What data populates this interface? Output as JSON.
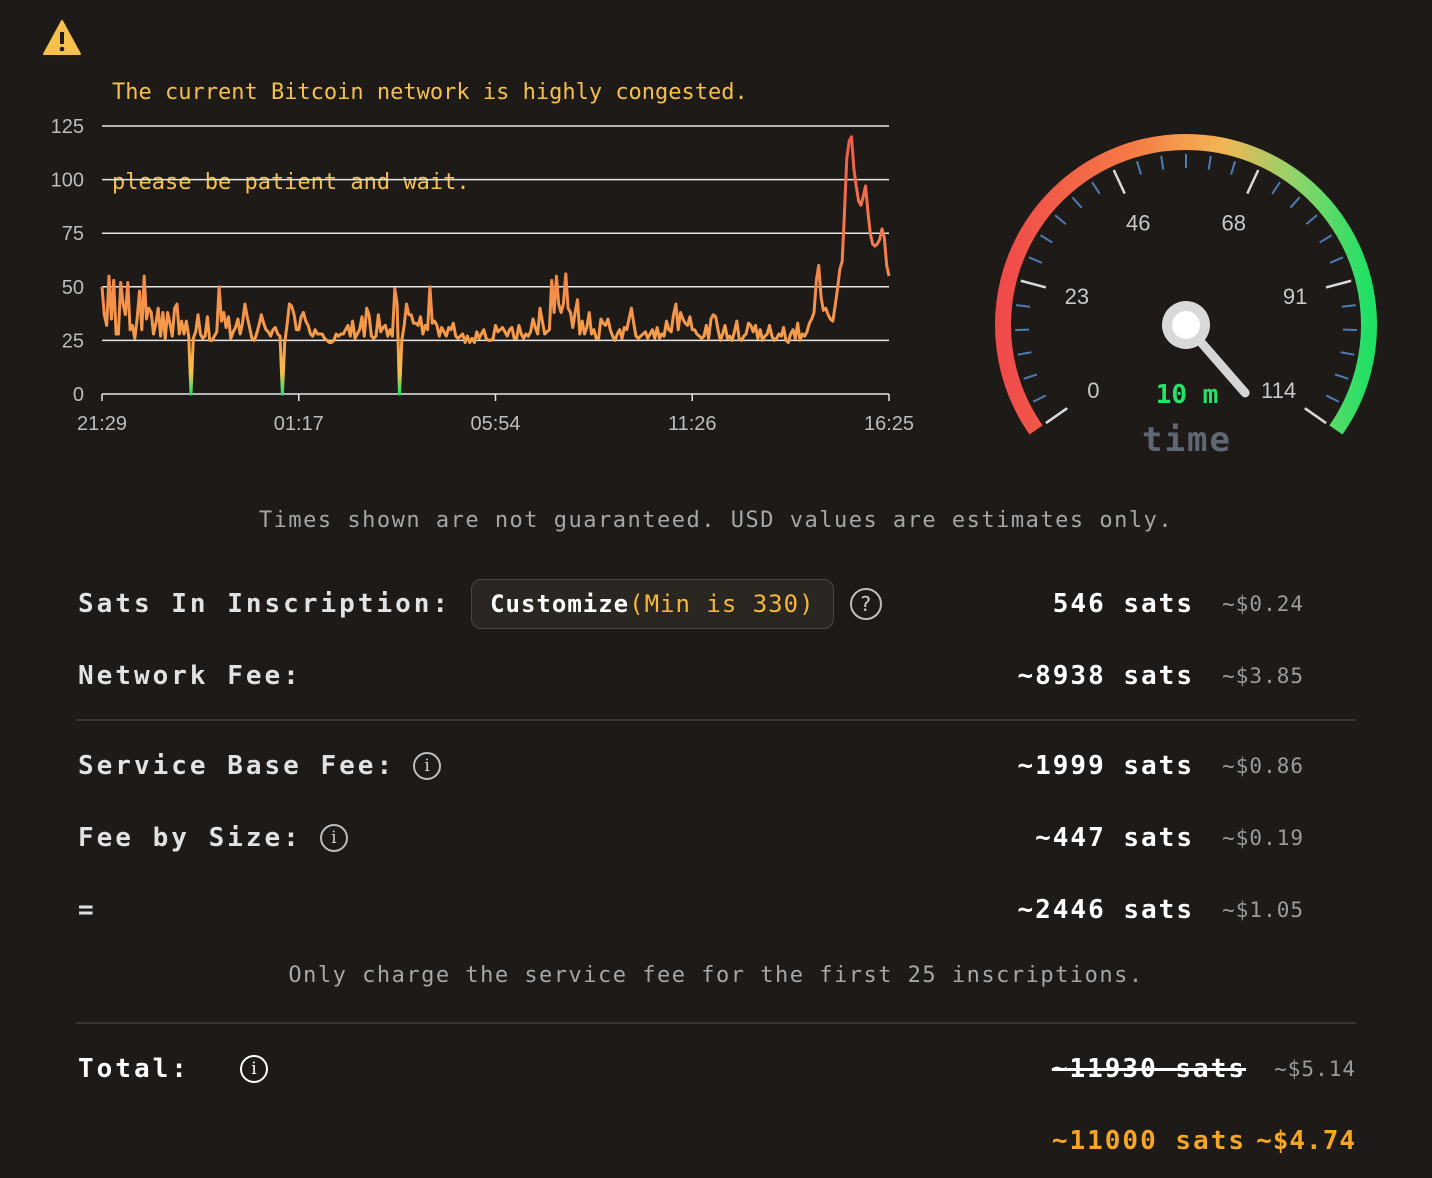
{
  "warning": {
    "icon": "warning-triangle-icon",
    "line1": "The current Bitcoin network is highly congested.",
    "line2": "please be patient and wait."
  },
  "chart_data": {
    "type": "line",
    "y_ticks": [
      "0",
      "25",
      "50",
      "75",
      "100",
      "125"
    ],
    "x_ticks": [
      "21:29",
      "01:17",
      "05:54",
      "11:26",
      "16:25"
    ],
    "ylim": [
      0,
      125
    ],
    "grid": true,
    "series": [
      {
        "values": [
          50,
          37,
          32,
          55,
          35,
          53,
          28,
          28,
          52,
          42,
          37,
          52,
          30,
          32,
          26,
          35,
          48,
          30,
          55,
          35,
          40,
          38,
          28,
          33,
          40,
          27,
          38,
          26,
          38,
          33,
          27,
          40,
          42,
          28,
          34,
          28,
          34,
          27,
          0,
          26,
          29,
          37,
          28,
          26,
          27,
          36,
          25,
          25,
          27,
          29,
          50,
          34,
          38,
          31,
          36,
          26,
          29,
          31,
          35,
          28,
          33,
          42,
          36,
          31,
          26,
          25,
          28,
          32,
          37,
          33,
          30,
          29,
          27,
          30,
          31,
          28,
          27,
          0,
          24,
          32,
          42,
          41,
          37,
          30,
          30,
          36,
          38,
          34,
          32,
          28,
          27,
          30,
          28,
          28,
          28,
          26,
          25,
          24,
          24,
          25,
          28,
          27,
          28,
          28,
          30,
          32,
          27,
          34,
          26,
          28,
          30,
          36,
          27,
          40,
          37,
          27,
          26,
          27,
          37,
          29,
          31,
          32,
          27,
          30,
          27,
          49,
          42,
          0,
          25,
          32,
          42,
          37,
          37,
          33,
          33,
          32,
          36,
          28,
          32,
          30,
          50,
          33,
          34,
          32,
          27,
          31,
          29,
          27,
          31,
          30,
          33,
          27,
          26,
          27,
          28,
          24,
          27,
          24,
          26,
          24,
          29,
          26,
          28,
          30,
          26,
          25,
          25,
          26,
          32,
          29,
          30,
          31,
          29,
          27,
          30,
          31,
          26,
          26,
          32,
          28,
          26,
          28,
          27,
          29,
          35,
          31,
          28,
          40,
          34,
          28,
          29,
          30,
          53,
          38,
          55,
          42,
          38,
          42,
          56,
          40,
          38,
          31,
          38,
          44,
          28,
          34,
          28,
          31,
          38,
          28,
          30,
          26,
          26,
          35,
          33,
          32,
          35,
          30,
          27,
          25,
          28,
          30,
          26,
          31,
          30,
          35,
          40,
          33,
          27,
          26,
          27,
          28,
          29,
          26,
          28,
          30,
          26,
          31,
          26,
          28,
          27,
          34,
          30,
          29,
          37,
          42,
          30,
          38,
          35,
          33,
          32,
          36,
          30,
          30,
          28,
          27,
          26,
          27,
          32,
          26,
          35,
          37,
          36,
          30,
          25,
          28,
          32,
          26,
          27,
          25,
          29,
          34,
          26,
          25,
          27,
          28,
          33,
          32,
          29,
          32,
          26,
          30,
          25,
          27,
          28,
          32,
          27,
          25,
          26,
          28,
          27,
          31,
          25,
          24,
          28,
          30,
          26,
          33,
          25,
          28,
          27,
          29,
          33,
          35,
          38,
          53,
          60,
          45,
          39,
          40,
          37,
          35,
          34,
          41,
          49,
          58,
          62,
          85,
          110,
          118,
          120,
          105,
          97,
          90,
          88,
          92,
          97,
          85,
          75,
          70,
          69,
          70,
          72,
          77,
          73,
          60,
          55
        ]
      }
    ]
  },
  "gauge": {
    "ticks": [
      "0",
      "23",
      "46",
      "68",
      "91",
      "114"
    ],
    "value": 10,
    "time_value": "10 m",
    "time_label": "time"
  },
  "disclaimer1": "Times shown are not guaranteed. USD values are estimates only.",
  "rows": {
    "inscription": {
      "label": "Sats In Inscription:",
      "customize": "Customize",
      "min": "(Min is 330)",
      "help_icon": "question-circle-icon",
      "sats": "546 sats",
      "usd": "~$0.24"
    },
    "network": {
      "label": "Network Fee:",
      "sats": "~8938 sats",
      "usd": "~$3.85"
    },
    "service_base": {
      "label": "Service Base Fee:",
      "info_icon": "info-circle-icon",
      "sats": "~1999 sats",
      "usd": "~$0.86"
    },
    "fee_size": {
      "label": "Fee by Size:",
      "info_icon": "info-circle-icon",
      "sats": "~447 sats",
      "usd": "~$0.19"
    },
    "equals": {
      "label": "=",
      "sats": "~2446 sats",
      "usd": "~$1.05"
    }
  },
  "disclaimer2": "Only charge the service fee for the first 25 inscriptions.",
  "total": {
    "label": "Total:",
    "info_icon": "info-circle-icon",
    "old_sats": "~11930 sats",
    "old_usd": "~$5.14",
    "new_sats": "~11000 sats",
    "new_usd": "~$4.74"
  },
  "colors": {
    "background": "#1d1a17",
    "warning": "#f5c04c",
    "line": "#f2564b",
    "dip": "#22e36b",
    "accent_orange": "#f5a623"
  }
}
